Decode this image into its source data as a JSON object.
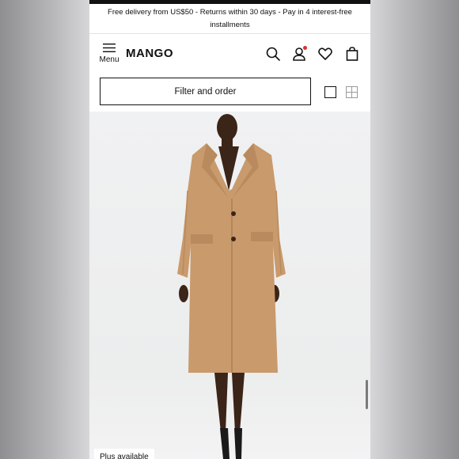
{
  "promo_bar": {
    "text": "Free delivery from US$50 - Returns within 30 days - Pay in 4 interest-free installments"
  },
  "header": {
    "menu_label": "Menu",
    "logo": "MANGO",
    "icons": [
      "search-icon",
      "account-icon",
      "heart-icon",
      "bag-icon"
    ],
    "notification_dot_color": "#d63232"
  },
  "toolbar": {
    "filter_label": "Filter and order",
    "view_options": [
      "single-column-view-icon",
      "grid-view-icon"
    ]
  },
  "product": {
    "badge": "Plus available",
    "coat_color": "#c99a6c"
  }
}
